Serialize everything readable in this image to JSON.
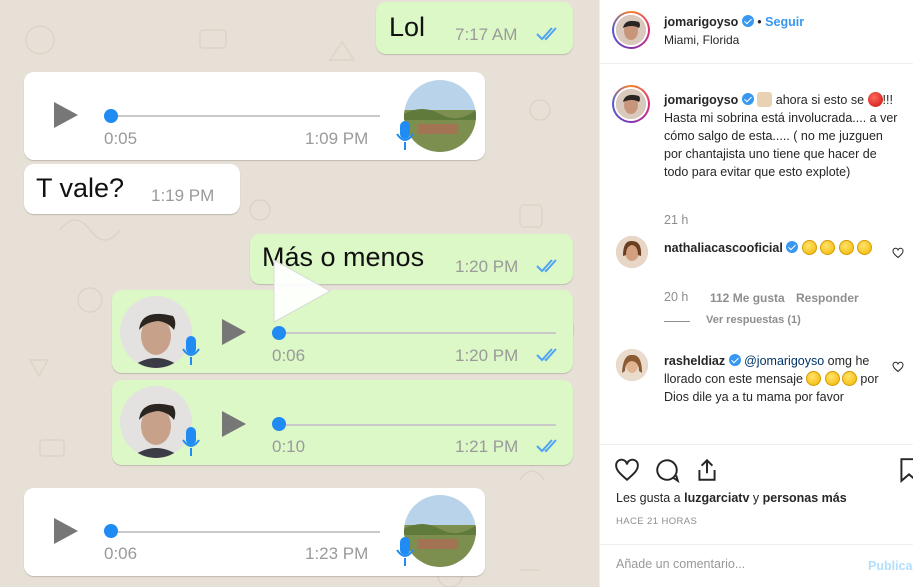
{
  "chat": {
    "messages": [
      {
        "text": "Lol",
        "time": "7:17 AM"
      },
      {
        "duration": "0:05",
        "time": "1:09 PM"
      },
      {
        "text": "T vale?",
        "time": "1:19 PM"
      },
      {
        "text": "Más o menos",
        "time": "1:20 PM"
      },
      {
        "duration": "0:06",
        "time": "1:20 PM"
      },
      {
        "duration": "0:10",
        "time": "1:21 PM"
      },
      {
        "duration": "0:06",
        "time": "1:23 PM"
      }
    ]
  },
  "post": {
    "author": {
      "username": "jomarigoyso",
      "verified": true,
      "follow_label": "Seguir",
      "location": "Miami, Florida"
    },
    "caption": {
      "username": "jomarigoyso",
      "text_1": " ahora si esto se ",
      "text_2": "!!! Hasta mi sobrina está involucrada.... a ver cómo salgo de esta..... ( no me juzguen por chantajista uno tiene que hacer de todo para evitar que esto explote)",
      "time": "21 h"
    },
    "comments": [
      {
        "username": "nathaliacascooficial",
        "time": "20 h",
        "likes": "112 Me gusta",
        "reply_label": "Responder",
        "view_replies": "Ver respuestas (1)"
      },
      {
        "username": "rasheldiaz",
        "mention": "@jomarigoyso",
        "text_1": " omg he llorado con este mensaje ",
        "text_2": " por Dios dile ya a tu mama por favor"
      }
    ],
    "likes_prefix": "Les gusta a ",
    "likes_user": "luzgarciatv",
    "likes_mid": " y ",
    "likes_rest": "personas más",
    "posted_ago": "HACE 21 HORAS",
    "comment_placeholder": "Añade un comentario...",
    "publish_label": "Publica"
  },
  "colors": {
    "chat_bg": "#e7e0d6",
    "outgoing": "#dcf8c6",
    "incoming": "#ffffff",
    "ig_blue": "#3897f0",
    "tick_blue": "#4fa3f7"
  },
  "icons": [
    "play-icon",
    "mic-icon",
    "double-check-icon",
    "verified-icon",
    "heart-icon",
    "comment-icon",
    "share-icon",
    "bookmark-icon"
  ]
}
